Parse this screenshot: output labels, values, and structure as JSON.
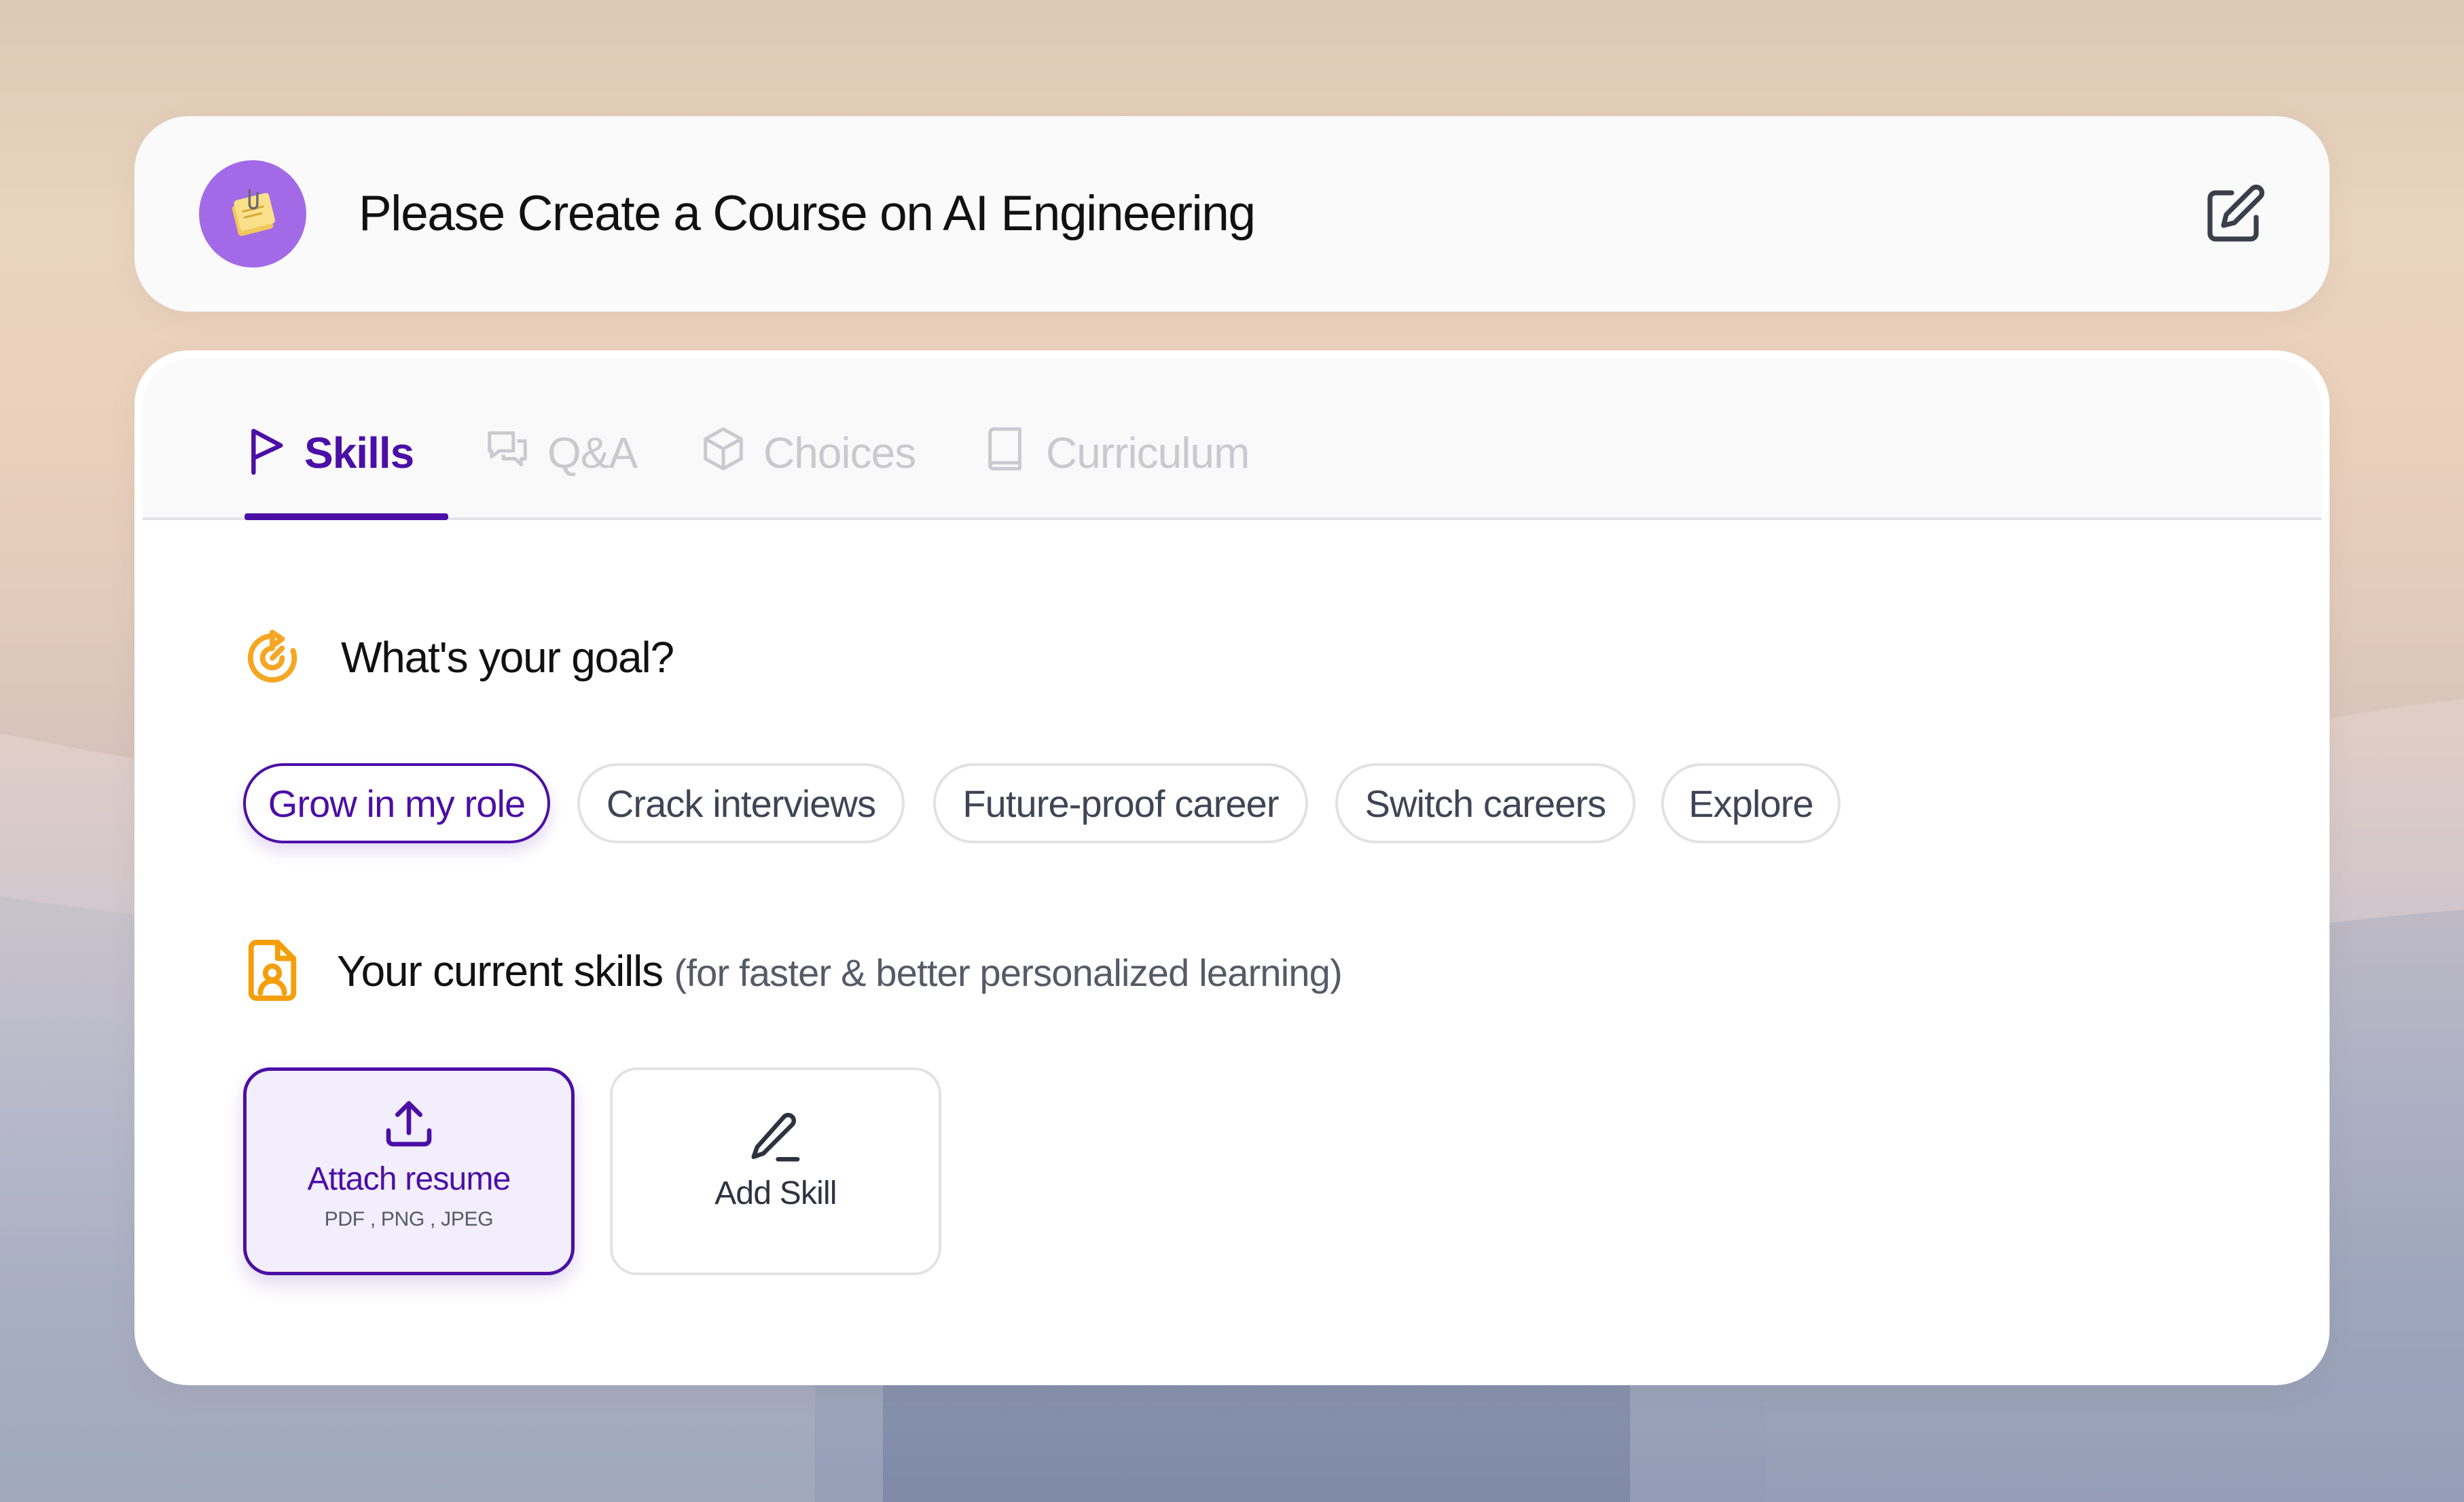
{
  "header": {
    "title": "Please Create a Course on AI Engineering",
    "avatar_icon": "sticky-note-icon",
    "edit_icon": "edit-icon"
  },
  "tabs": [
    {
      "label": "Skills",
      "icon": "flag-icon",
      "active": true
    },
    {
      "label": "Q&A",
      "icon": "chat-bubbles-icon",
      "active": false
    },
    {
      "label": "Choices",
      "icon": "cube-icon",
      "active": false
    },
    {
      "label": "Curriculum",
      "icon": "book-icon",
      "active": false
    }
  ],
  "goal": {
    "title": "What's your goal?",
    "icon": "target-icon",
    "options": [
      {
        "label": "Grow in my role",
        "selected": true
      },
      {
        "label": "Crack interviews",
        "selected": false
      },
      {
        "label": "Future-proof career",
        "selected": false
      },
      {
        "label": "Switch careers",
        "selected": false
      },
      {
        "label": "Explore",
        "selected": false
      }
    ]
  },
  "skills": {
    "title": "Your current skills",
    "subtitle": "(for faster & better personalized learning)",
    "icon": "resume-file-icon",
    "attach": {
      "label": "Attach resume",
      "formats": "PDF , PNG , JPEG",
      "icon": "upload-icon"
    },
    "add": {
      "label": "Add Skill",
      "icon": "pencil-icon"
    }
  },
  "colors": {
    "accent": "#4b0fa6",
    "avatar_bg": "#a36ae8",
    "goal_icon": "#f5a623",
    "selected_card_bg": "#f3eefc"
  }
}
